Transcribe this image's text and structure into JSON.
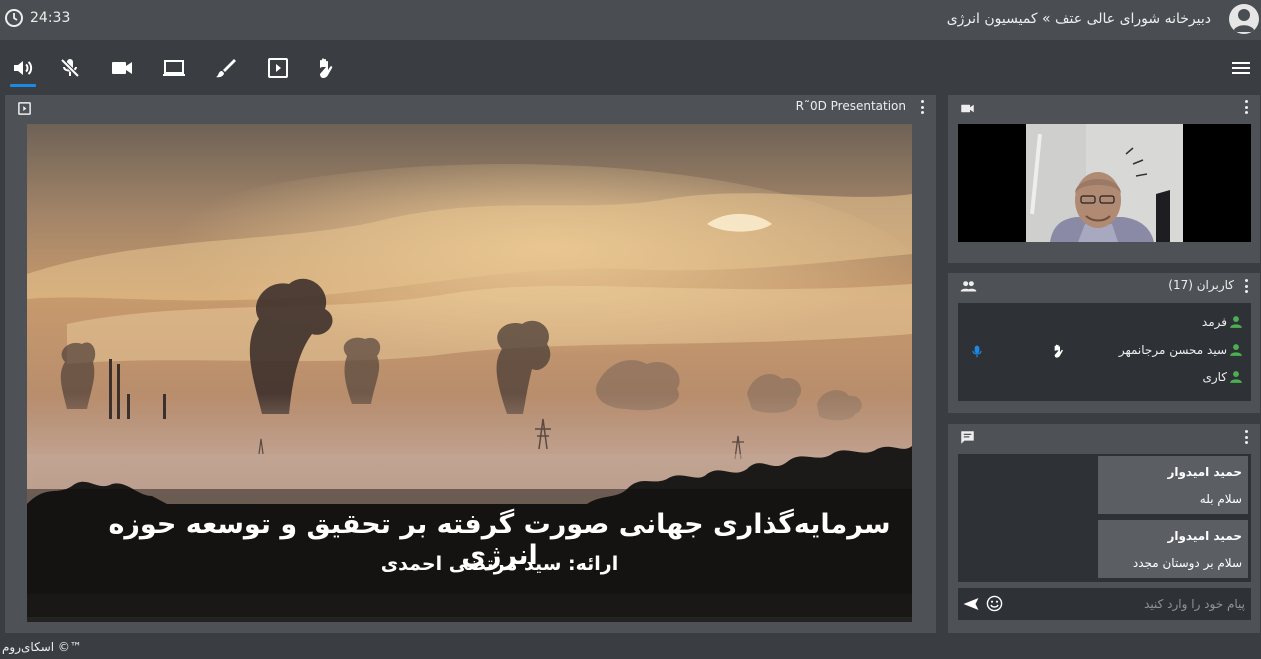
{
  "header": {
    "clock": "24:33",
    "breadcrumb": "دبیرخانه شورای عالی عتف » کمیسیون انرژی"
  },
  "toolbar": {
    "icons": [
      "speaker-icon",
      "mic-off-icon",
      "camera-icon",
      "screen-share-icon",
      "brush-icon",
      "presentation-icon",
      "raise-hand-icon"
    ],
    "active": "speaker-icon"
  },
  "presentation": {
    "title": "R˜0D Presentation",
    "slide_title": "سرمایه‌گذاری جهانی صورت گرفته بر تحقیق و توسعه حوزه انرژی",
    "slide_subtitle": "ارائه: سید مرتضی احمدی"
  },
  "users": {
    "header": "کاربران (17)",
    "list": [
      {
        "name": "فرمد",
        "mic": false,
        "hand": false
      },
      {
        "name": "سید محسن مرجانمهر",
        "mic": true,
        "hand": true
      },
      {
        "name": "کاری",
        "mic": false,
        "hand": false
      }
    ]
  },
  "chat": {
    "messages": [
      {
        "author": "حمید امیدوار",
        "text": "سلام بله"
      },
      {
        "author": "حمید امیدوار",
        "text": "سلام بر دوستان مجدد"
      }
    ],
    "placeholder": "پیام خود را وارد کنید"
  },
  "footer": {
    "brand": "اسکای‌روم ©™"
  },
  "colors": {
    "accent": "#1e88e5",
    "user_online": "#4caf50",
    "panel": "#4e5155",
    "background": "#3a3d41"
  }
}
